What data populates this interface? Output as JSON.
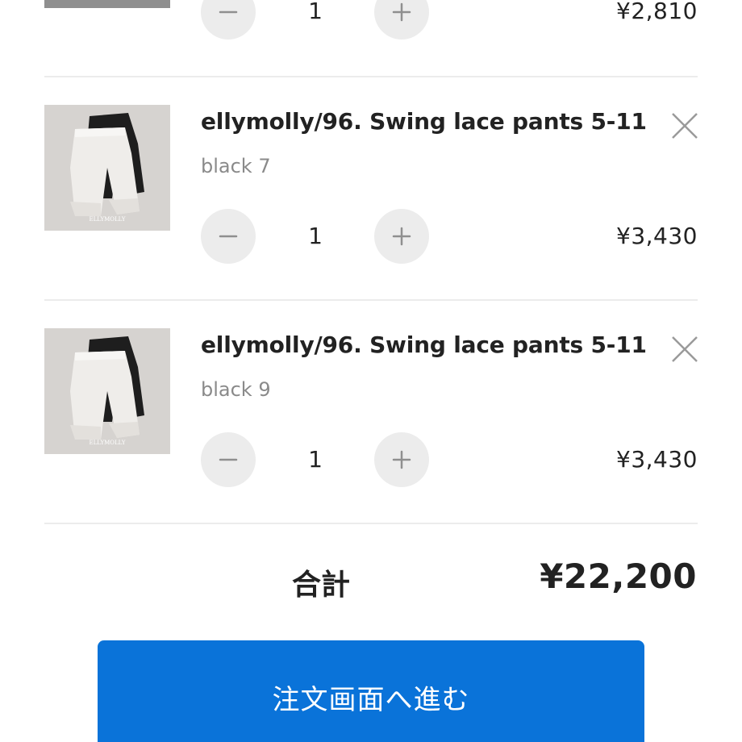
{
  "cart": {
    "items": [
      {
        "title": "",
        "variant": "",
        "quantity": "1",
        "price": "¥2,810"
      },
      {
        "title": "ellymolly/96. Swing lace pants 5-11",
        "variant": "black 7",
        "quantity": "1",
        "price": "¥3,430",
        "thumb_brand": "ELLYMOLLY"
      },
      {
        "title": "ellymolly/96. Swing lace pants 5-11",
        "variant": "black 9",
        "quantity": "1",
        "price": "¥3,430",
        "thumb_brand": "ELLYMOLLY"
      }
    ]
  },
  "summary": {
    "total_label": "合計",
    "total_value": "¥22,200"
  },
  "checkout": {
    "label": "注文画面へ進む"
  },
  "colors": {
    "accent": "#0a73d9",
    "stepper_bg": "#ececec",
    "muted_text": "#8a8a8a",
    "divider": "#ececec"
  },
  "icons": {
    "decrease": "minus-icon",
    "increase": "plus-icon",
    "remove": "close-icon"
  }
}
